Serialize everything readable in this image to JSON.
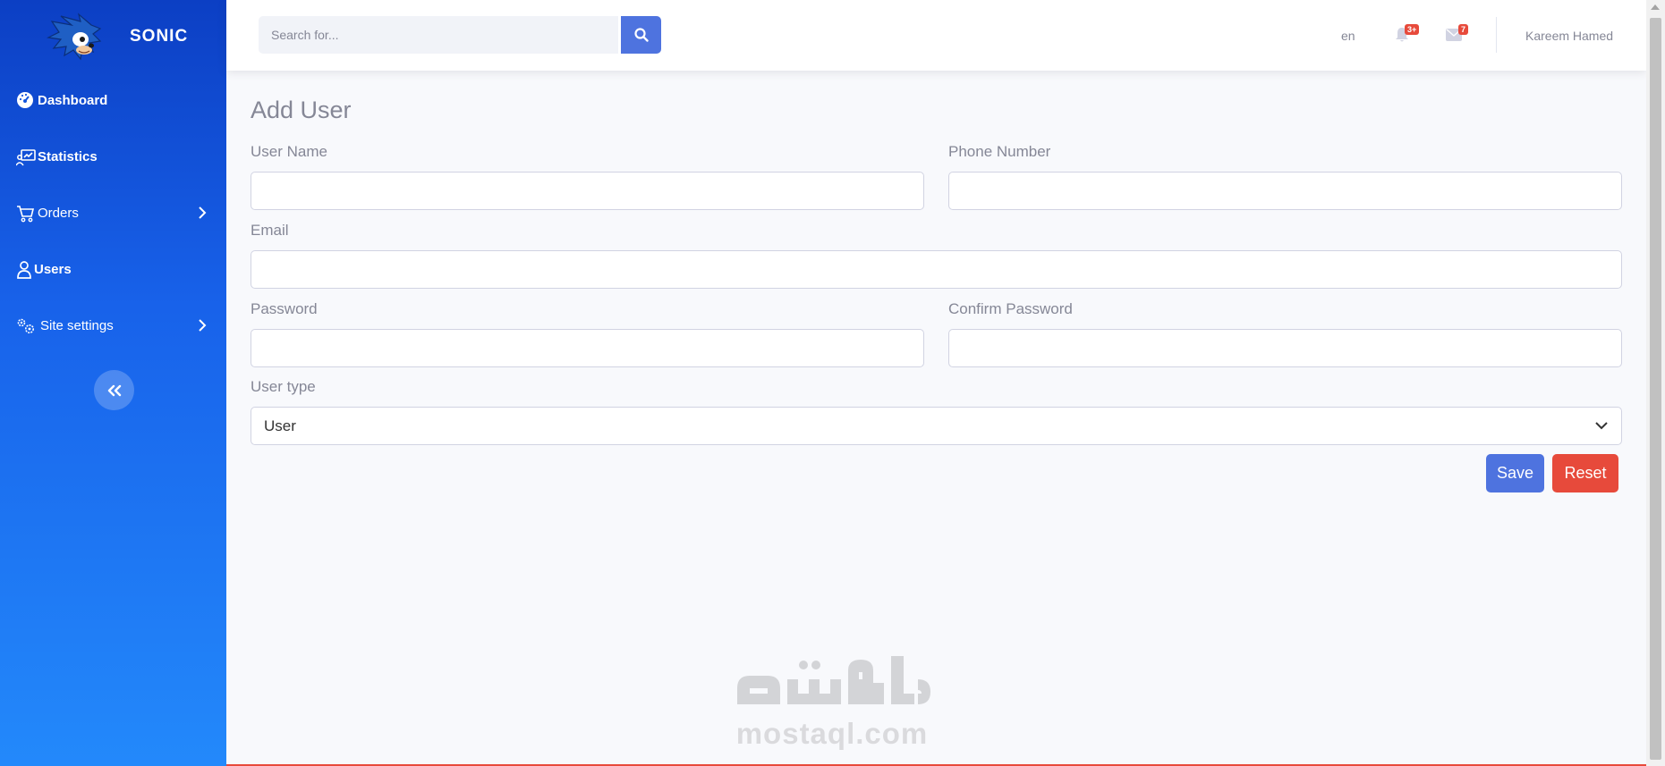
{
  "brand": {
    "name": "SONIC"
  },
  "sidebar": {
    "items": [
      {
        "label": "Dashboard",
        "icon": "dashboard-icon"
      },
      {
        "label": "Statistics",
        "icon": "statistics-icon"
      },
      {
        "label": "Orders",
        "icon": "cart-icon",
        "has_submenu": true
      },
      {
        "label": "Users",
        "icon": "user-icon"
      },
      {
        "label": "Site settings",
        "icon": "gears-icon",
        "has_submenu": true
      }
    ]
  },
  "topbar": {
    "search": {
      "placeholder": "Search for..."
    },
    "language": "en",
    "alerts_badge": "3+",
    "messages_badge": "7",
    "user_name": "Kareem Hamed"
  },
  "main": {
    "page_title": "Add User",
    "fields": {
      "user_name": {
        "label": "User Name",
        "value": ""
      },
      "phone_number": {
        "label": "Phone Number",
        "value": ""
      },
      "email": {
        "label": "Email",
        "value": ""
      },
      "password": {
        "label": "Password",
        "value": ""
      },
      "confirm_password": {
        "label": "Confirm Password",
        "value": ""
      },
      "user_type": {
        "label": "User type",
        "value": "User"
      }
    },
    "save_label": "Save",
    "reset_label": "Reset"
  },
  "watermark": {
    "text": "mostaql.com"
  },
  "colors": {
    "primary": "#4e73df",
    "danger": "#e74a3b",
    "sidebar_top": "#0c3fc4",
    "sidebar_bottom": "#2389fb",
    "text_muted": "#858796"
  }
}
